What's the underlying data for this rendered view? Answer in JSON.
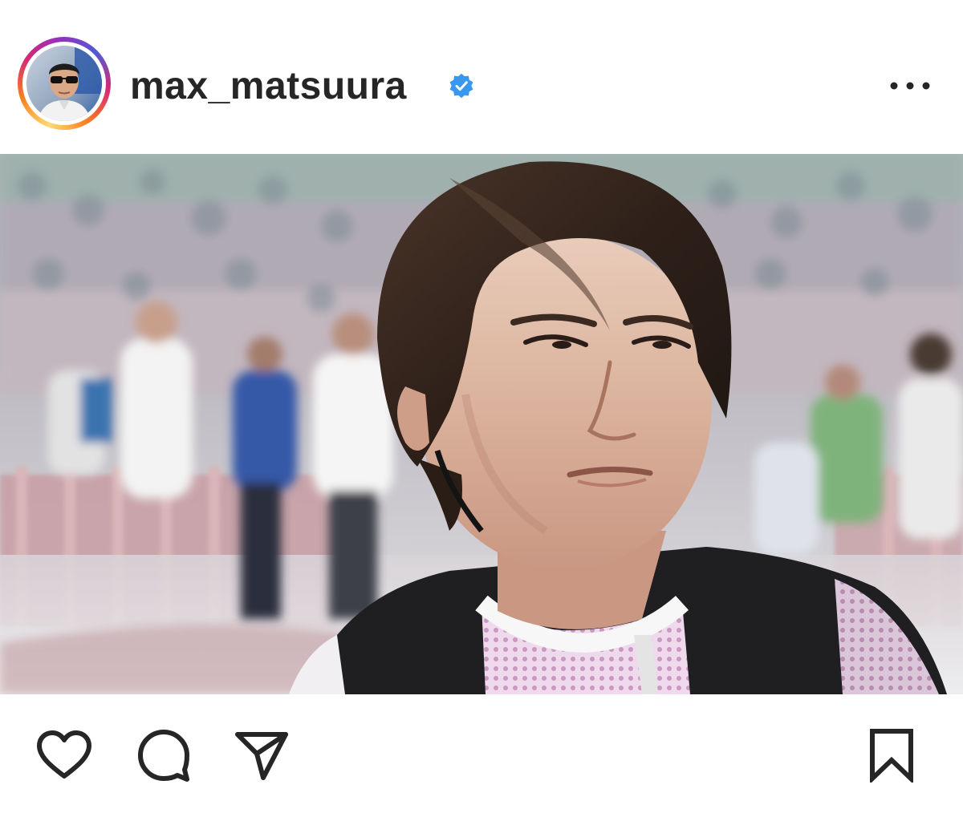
{
  "post": {
    "username": "max_matsuura",
    "verified": true,
    "avatar_icon": "profile-photo-avatar",
    "more_icon": "more-options-icon"
  },
  "image": {
    "description_icon": "post-photo"
  },
  "actions": {
    "left": [
      "heart-icon",
      "comment-icon",
      "share-icon"
    ],
    "right": [
      "bookmark-icon"
    ]
  },
  "colors": {
    "text": "#262626",
    "verified": "#3897f0",
    "ring_start": "#feda75",
    "ring_mid": "#d62976",
    "ring_end": "#962fbf"
  }
}
